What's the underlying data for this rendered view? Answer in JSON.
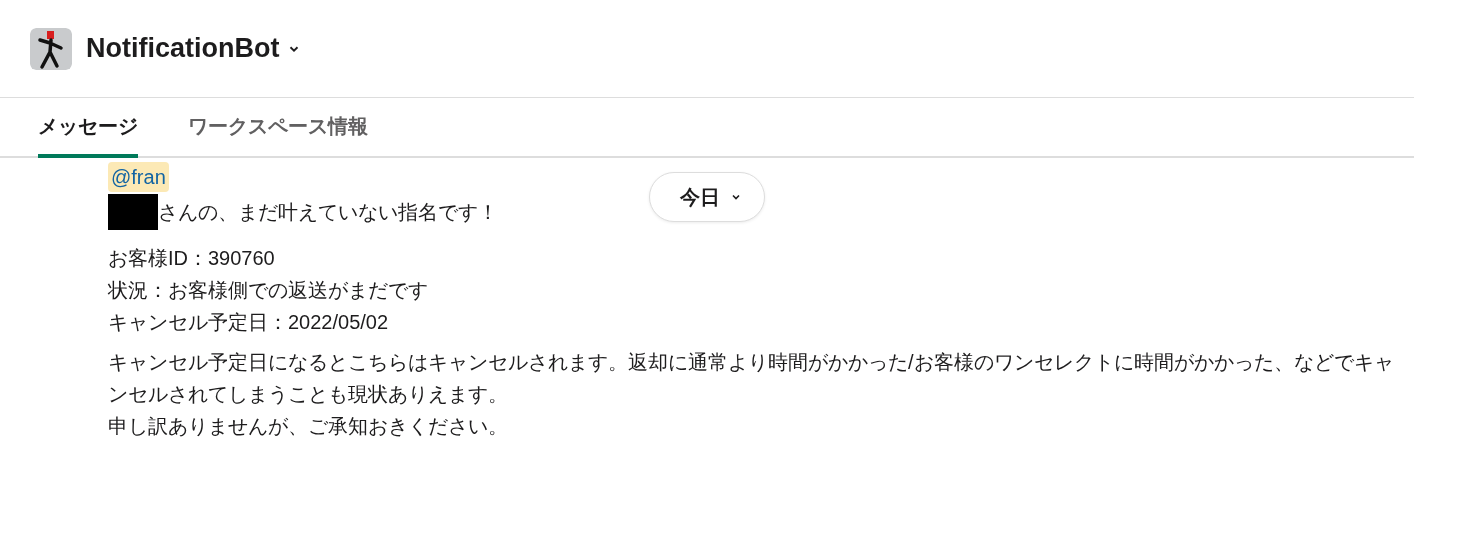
{
  "header": {
    "title": "NotificationBot"
  },
  "tabs": [
    {
      "label": "メッセージ",
      "selected": true
    },
    {
      "label": "ワークスペース情報",
      "selected": false
    }
  ],
  "date_divider": {
    "label": "今日"
  },
  "message": {
    "mention": "@fran",
    "intro": "さんの、まだ叶えていない指名です！",
    "details": [
      "お客様ID：390760",
      "状況：お客様側での返送がまだです",
      "キャンセル予定日：2022/05/02"
    ],
    "notice": [
      "キャンセル予定日になるとこちらはキャンセルされます。返却に通常より時間がかかった/お客様のワンセレクトに時間がかかった、などでキャンセルされてしまうことも現状ありえます。",
      "申し訳ありませんが、ご承知おきください。"
    ]
  }
}
